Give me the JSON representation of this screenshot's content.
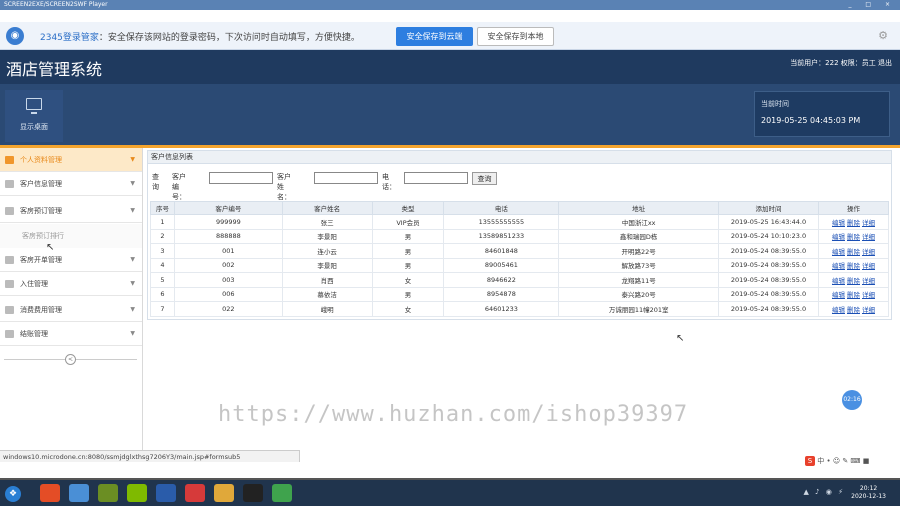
{
  "window": {
    "title": "SCREEN2EXE/SCREEN2SWF Player",
    "controls": [
      "_",
      "□",
      "×"
    ]
  },
  "password_bar": {
    "brand": "2345登录管家",
    "message": "：安全保存该网站的登录密码，下次访问时自动填写，方便快捷。",
    "save_cloud": "安全保存到云端",
    "save_local": "安全保存到本地"
  },
  "header": {
    "app_title": "酒店管理系统",
    "user_info": "当前用户：222  权限：员工  退出"
  },
  "nav": {
    "display_tile": "显示桌面"
  },
  "time_box": {
    "label": "当前时间",
    "value": "2019-05-25 04:45:03 PM"
  },
  "sidebar": {
    "items": [
      {
        "label": "个人资料管理",
        "active": true
      },
      {
        "label": "客户信息管理",
        "active": false
      },
      {
        "label": "客房预订管理",
        "active": false
      },
      {
        "label": "客房开单管理",
        "active": false
      },
      {
        "label": "入住管理",
        "active": false
      },
      {
        "label": "消费费用管理",
        "active": false
      },
      {
        "label": "结账管理",
        "active": false
      }
    ],
    "sub_item": "客房预订排行"
  },
  "content": {
    "section_title": "客户信息列表",
    "search": {
      "query_label": "查询",
      "id_label": "客户编号：",
      "name_label": "客户姓名：",
      "phone_label": "电话：",
      "button": "查询"
    },
    "table": {
      "headers": [
        "序号",
        "客户编号",
        "客户姓名",
        "类型",
        "电话",
        "地址",
        "添加时间",
        "操作"
      ],
      "rows": [
        [
          "1",
          "999999",
          "张三",
          "VIP会员",
          "13555555555",
          "中国浙江xx",
          "2019-05-25 16:43:44.0"
        ],
        [
          "2",
          "888888",
          "李景阳",
          "男",
          "13589851233",
          "鑫和瑞园D栋",
          "2019-05-24 10:10:23.0"
        ],
        [
          "3",
          "001",
          "连小云",
          "男",
          "84601848",
          "开明路22号",
          "2019-05-24 08:39:55.0"
        ],
        [
          "4",
          "002",
          "李景阳",
          "男",
          "89005461",
          "解放路73号",
          "2019-05-24 08:39:55.0"
        ],
        [
          "5",
          "003",
          "肖西",
          "女",
          "8946622",
          "龙翔路11号",
          "2019-05-24 08:39:55.0"
        ],
        [
          "6",
          "006",
          "慕依洁",
          "男",
          "8954878",
          "泰兴路20号",
          "2019-05-24 08:39:55.0"
        ],
        [
          "7",
          "022",
          "峨明",
          "女",
          "64601233",
          "万诚丽园11幢201室",
          "2019-05-24 08:39:55.0"
        ]
      ],
      "actions": [
        "编辑",
        "删除",
        "详细"
      ]
    }
  },
  "watermark": "https://www.huzhan.com/ishop39397",
  "timer_badge": "02:16",
  "status_url": "windows10.microdone.cn:8080/ssmjdglxthsg7206Y3/main.jsp#formsub5",
  "ime_label": "中",
  "taskbar": {
    "clock_time": "20:12",
    "clock_date": "2020-12-13",
    "app_colors": [
      "#e44d26",
      "#4a8fd6",
      "#6b8e23",
      "#7fba00",
      "#2a5caa",
      "#d63a3a",
      "#e0a83a",
      "#222222",
      "#3fa34d"
    ]
  }
}
